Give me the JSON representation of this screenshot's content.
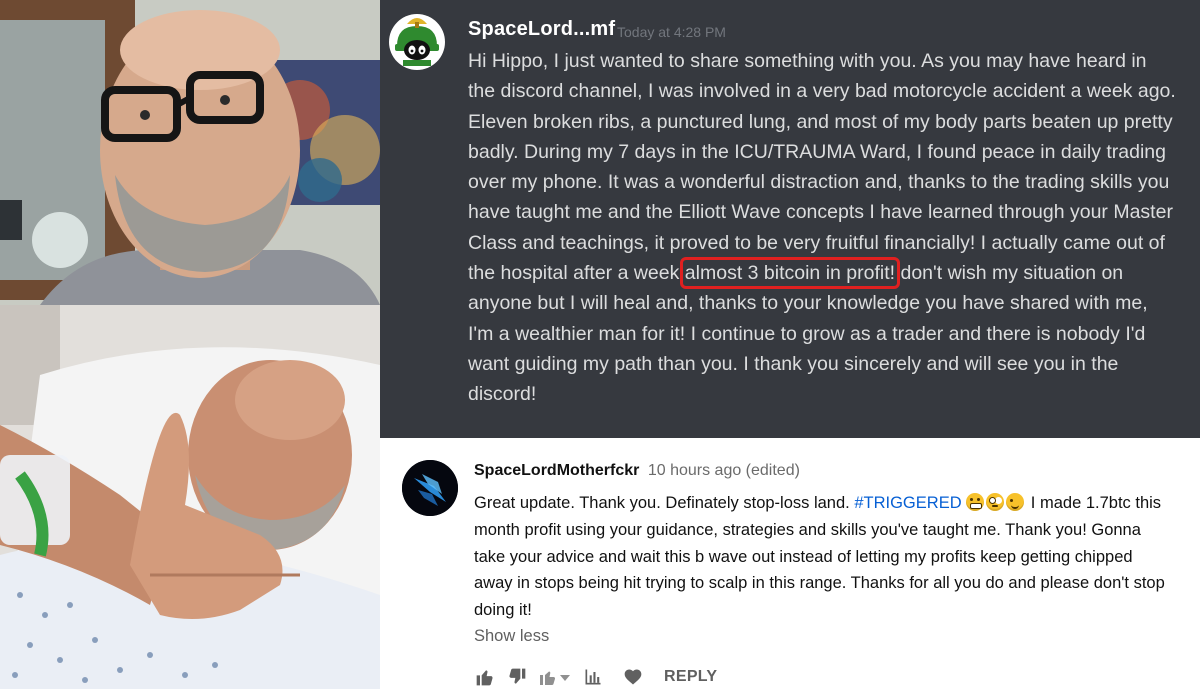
{
  "discord": {
    "username": "SpaceLord...mf",
    "timestamp": "Today at 4:28 PM",
    "message_before": "Hi Hippo, I just wanted to share something with you. As you may have heard in the discord channel, I was involved in a very bad motorcycle accident a week ago. Eleven broken ribs, a punctured lung, and most of my body parts beaten up pretty badly. During my 7 days in the ICU/TRAUMA Ward, I found peace in daily trading over my phone. It was a wonderful distraction and, thanks to the trading skills you have taught me and the Elliott Wave concepts I have learned through your Master Class and teachings, it proved to be very fruitful financially! I actually came out of the hospital after a week ",
    "message_highlight": "almost 3 bitcoin in profit!",
    "message_after": " don't wish my situation on anyone but I will heal and, thanks to your knowledge you have shared with me, I'm a wealthier man for it! I continue to grow as a trader and there is nobody I'd want guiding my path than you. I thank you sincerely and will see you in the discord!",
    "highlight_color": "#e02020",
    "background_color": "#36393f",
    "avatar_icon": "marvin-martian-avatar"
  },
  "youtube": {
    "author": "SpaceLordMotherfckr",
    "meta": "10 hours ago (edited)",
    "comment_part1": "Great update. Thank you. Definately stop-loss land. ",
    "hashtag": "#TRIGGERED",
    "emojis": [
      "grimacing-face-emoji",
      "face-with-rolling-eyes-emoji",
      "winking-face-emoji"
    ],
    "comment_part2": " I made 1.7btc this month profit using your guidance, strategies and skills you've taught me. Thank you! Gonna take your advice and wait this b wave out instead of letting my profits keep getting chipped away in stops being hit trying to scalp in this range. Thanks for all you do and please don't stop doing it!",
    "show_less": "Show less",
    "reply": "REPLY",
    "hashtag_color": "#065fd4",
    "action_icons": [
      "thumbs-up-icon",
      "thumbs-down-icon",
      "creator-heart-menu-icon",
      "analytics-icon",
      "heart-icon"
    ]
  },
  "photos": {
    "top": "man-with-glasses-selfie-photo",
    "bottom": "man-in-hospital-bed-thumbs-up-photo"
  }
}
